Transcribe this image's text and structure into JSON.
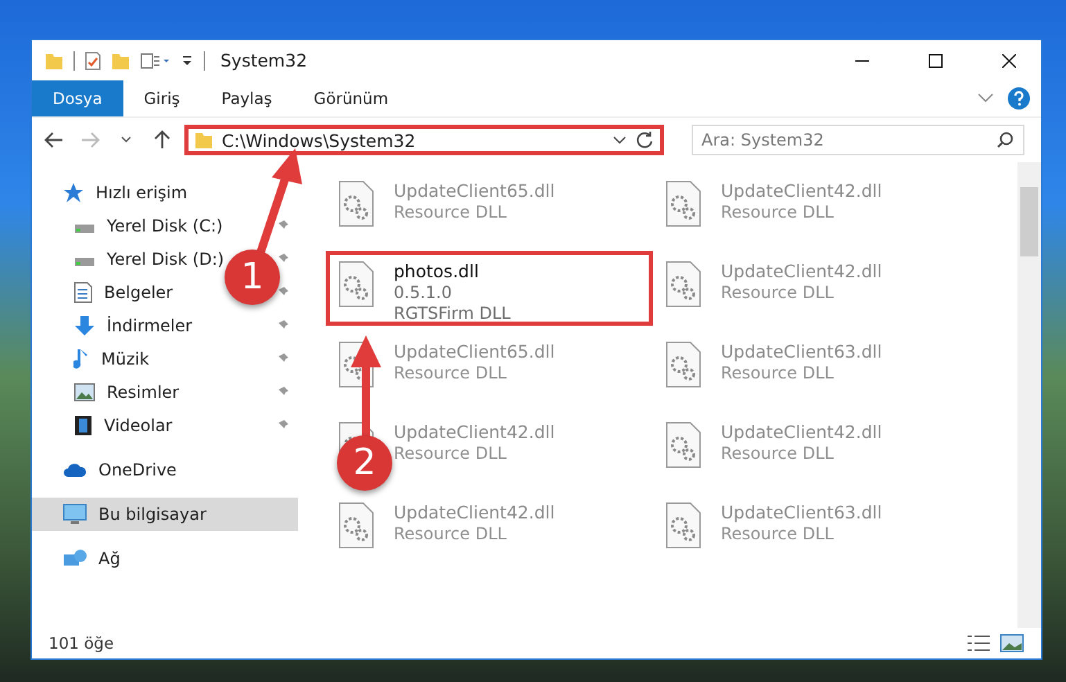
{
  "window": {
    "title": "System32"
  },
  "ribbon_tabs": [
    {
      "label": "Dosya",
      "selected": true
    },
    {
      "label": "Giriş",
      "selected": false
    },
    {
      "label": "Paylaş",
      "selected": false
    },
    {
      "label": "Görünüm",
      "selected": false
    }
  ],
  "address_bar": {
    "path": "C:\\Windows\\System32",
    "highlighted": true
  },
  "search": {
    "placeholder": "Ara: System32"
  },
  "sidebar": {
    "items": [
      {
        "label": "Hızlı erişim",
        "kind": "star",
        "selected": false,
        "children": [
          {
            "label": "Yerel Disk (C:)",
            "kind": "drive",
            "pinned": true,
            "selected": false
          },
          {
            "label": "Yerel Disk (D:)",
            "kind": "drive",
            "pinned": true,
            "selected": false
          },
          {
            "label": "Belgeler",
            "kind": "document",
            "pinned": true,
            "selected": false
          },
          {
            "label": "İndirmeler",
            "kind": "download",
            "pinned": true,
            "selected": false
          },
          {
            "label": "Müzik",
            "kind": "music",
            "pinned": true,
            "selected": false
          },
          {
            "label": "Resimler",
            "kind": "picture",
            "pinned": true,
            "selected": false
          },
          {
            "label": "Videolar",
            "kind": "video",
            "pinned": true,
            "selected": false
          }
        ]
      },
      {
        "label": "OneDrive",
        "kind": "cloud",
        "selected": false
      },
      {
        "label": "Bu bilgisayar",
        "kind": "computer",
        "selected": true
      },
      {
        "label": "Ağ",
        "kind": "network",
        "selected": false
      }
    ]
  },
  "files": [
    {
      "name": "UpdateClient65.dll",
      "details": [
        "Resource DLL"
      ],
      "blurred": true,
      "highlighted": false
    },
    {
      "name": "UpdateClient42.dll",
      "details": [
        "Resource DLL"
      ],
      "blurred": true,
      "highlighted": false
    },
    {
      "name": "photos.dll",
      "details": [
        "0.5.1.0",
        "RGTSFirm DLL"
      ],
      "blurred": false,
      "highlighted": true
    },
    {
      "name": "UpdateClient42.dll",
      "details": [
        "Resource DLL"
      ],
      "blurred": true,
      "highlighted": false
    },
    {
      "name": "UpdateClient65.dll",
      "details": [
        "Resource DLL"
      ],
      "blurred": true,
      "highlighted": false
    },
    {
      "name": "UpdateClient63.dll",
      "details": [
        "Resource DLL"
      ],
      "blurred": true,
      "highlighted": false
    },
    {
      "name": "UpdateClient42.dll",
      "details": [
        "Resource DLL"
      ],
      "blurred": true,
      "highlighted": false
    },
    {
      "name": "UpdateClient42.dll",
      "details": [
        "Resource DLL"
      ],
      "blurred": true,
      "highlighted": false
    },
    {
      "name": "UpdateClient42.dll",
      "details": [
        "Resource DLL"
      ],
      "blurred": true,
      "highlighted": false
    },
    {
      "name": "UpdateClient63.dll",
      "details": [
        "Resource DLL"
      ],
      "blurred": true,
      "highlighted": false
    }
  ],
  "status_bar": {
    "item_count": "101 öğe"
  },
  "annotations": [
    {
      "number": "1"
    },
    {
      "number": "2"
    }
  ]
}
